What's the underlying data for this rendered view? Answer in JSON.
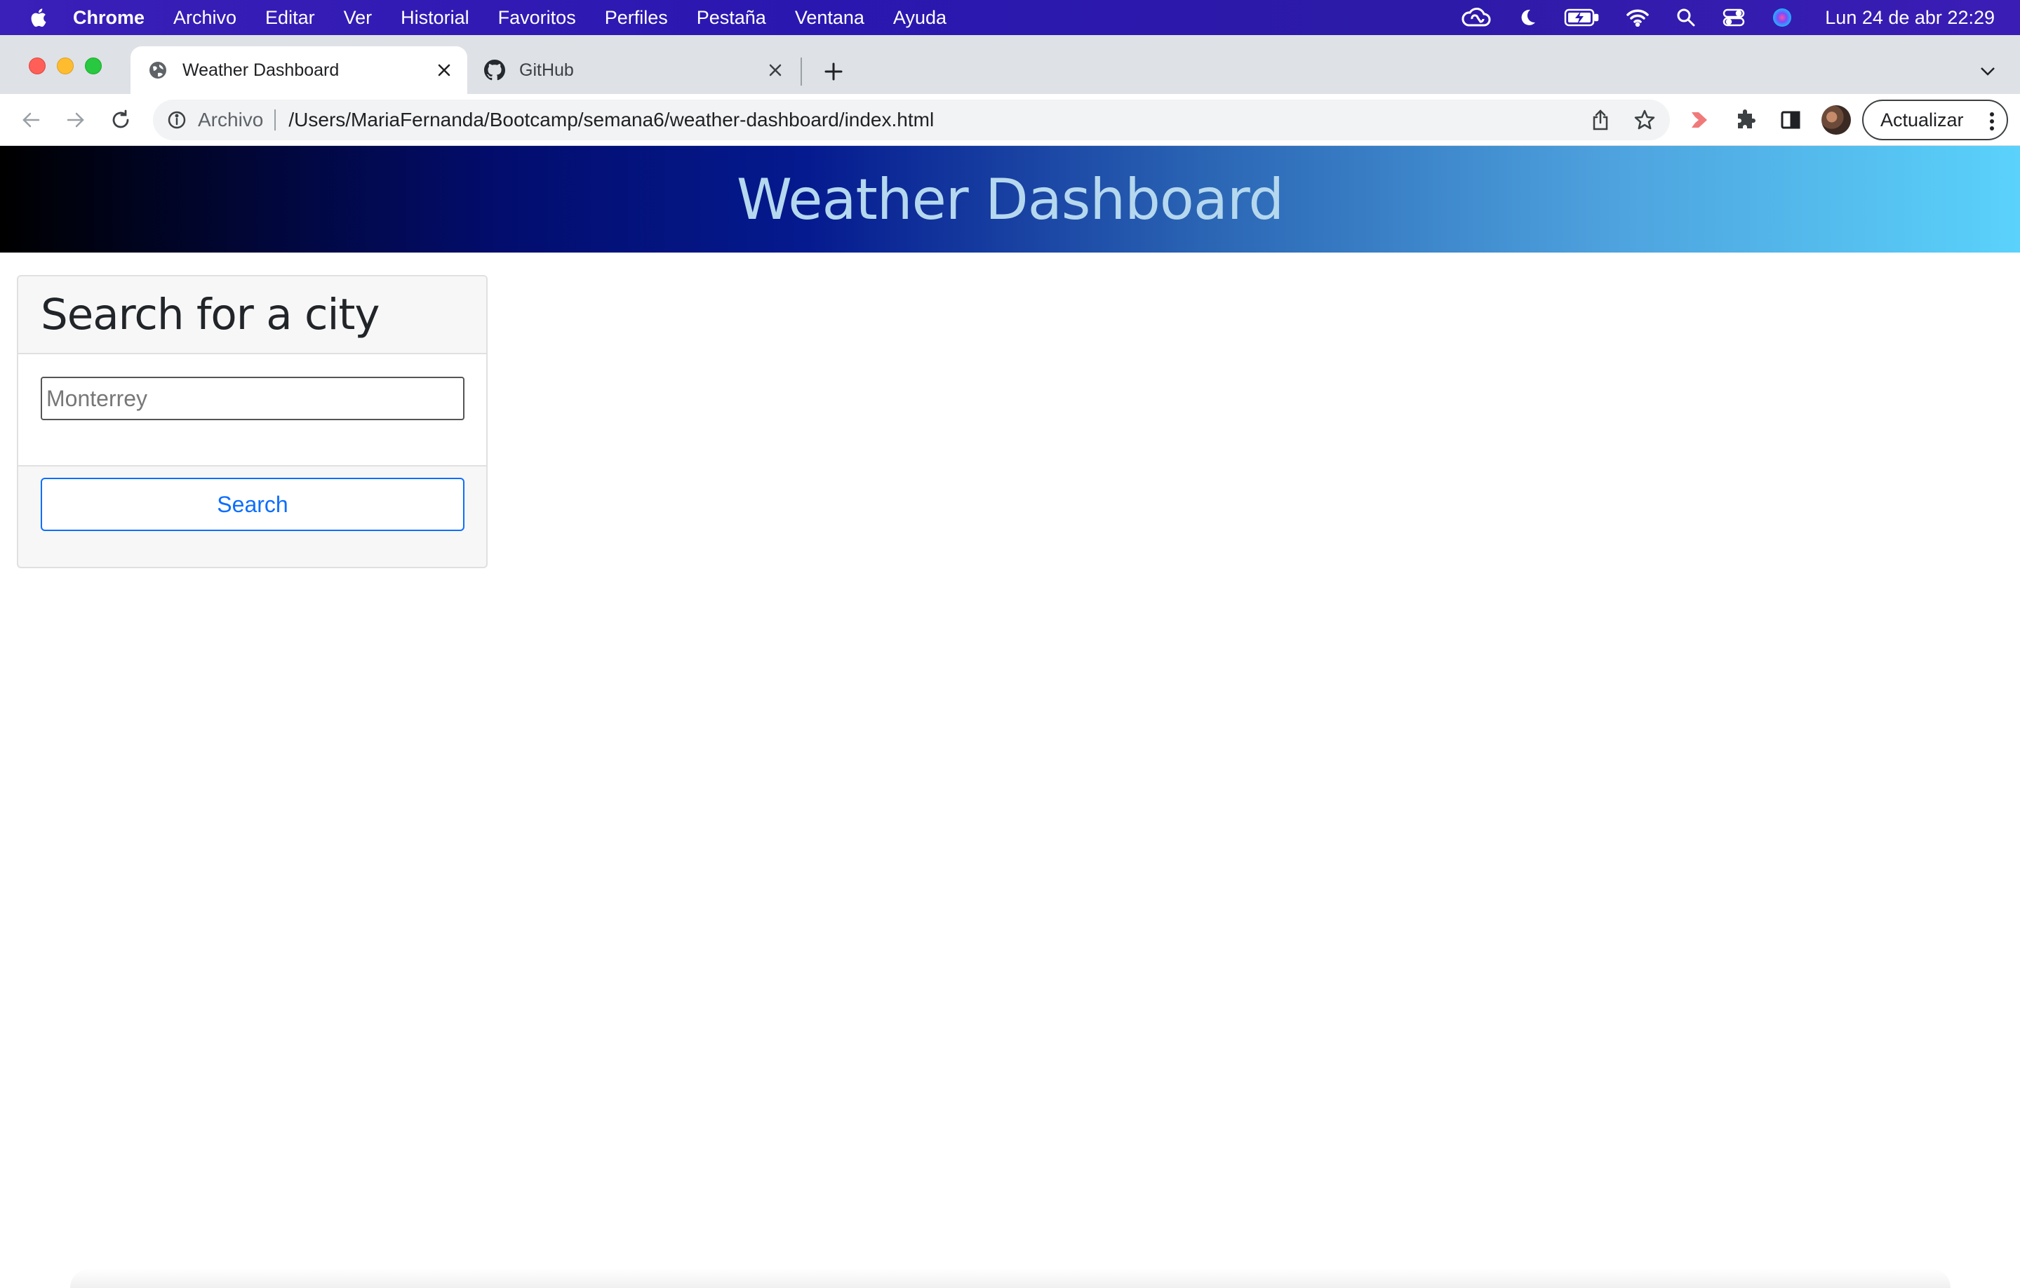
{
  "menubar": {
    "app_name": "Chrome",
    "items": [
      "Archivo",
      "Editar",
      "Ver",
      "Historial",
      "Favoritos",
      "Perfiles",
      "Pestaña",
      "Ventana",
      "Ayuda"
    ],
    "clock": "Lun 24 de abr  22:29"
  },
  "tabs": [
    {
      "title": "Weather Dashboard",
      "icon": "globe-icon",
      "active": true
    },
    {
      "title": "GitHub",
      "icon": "github-icon",
      "active": false
    }
  ],
  "toolbar": {
    "scheme_label": "Archivo",
    "url": "/Users/MariaFernanda/Bootcamp/semana6/weather-dashboard/index.html",
    "update_label": "Actualizar"
  },
  "page": {
    "title": "Weather Dashboard",
    "card_title": "Search for a city",
    "input_placeholder": "Monterrey",
    "search_label": "Search"
  },
  "colors": {
    "menubar": "#2a17b0",
    "link_blue": "#0d6efd",
    "hero_start": "#000000",
    "hero_end": "#5ad2fb"
  }
}
